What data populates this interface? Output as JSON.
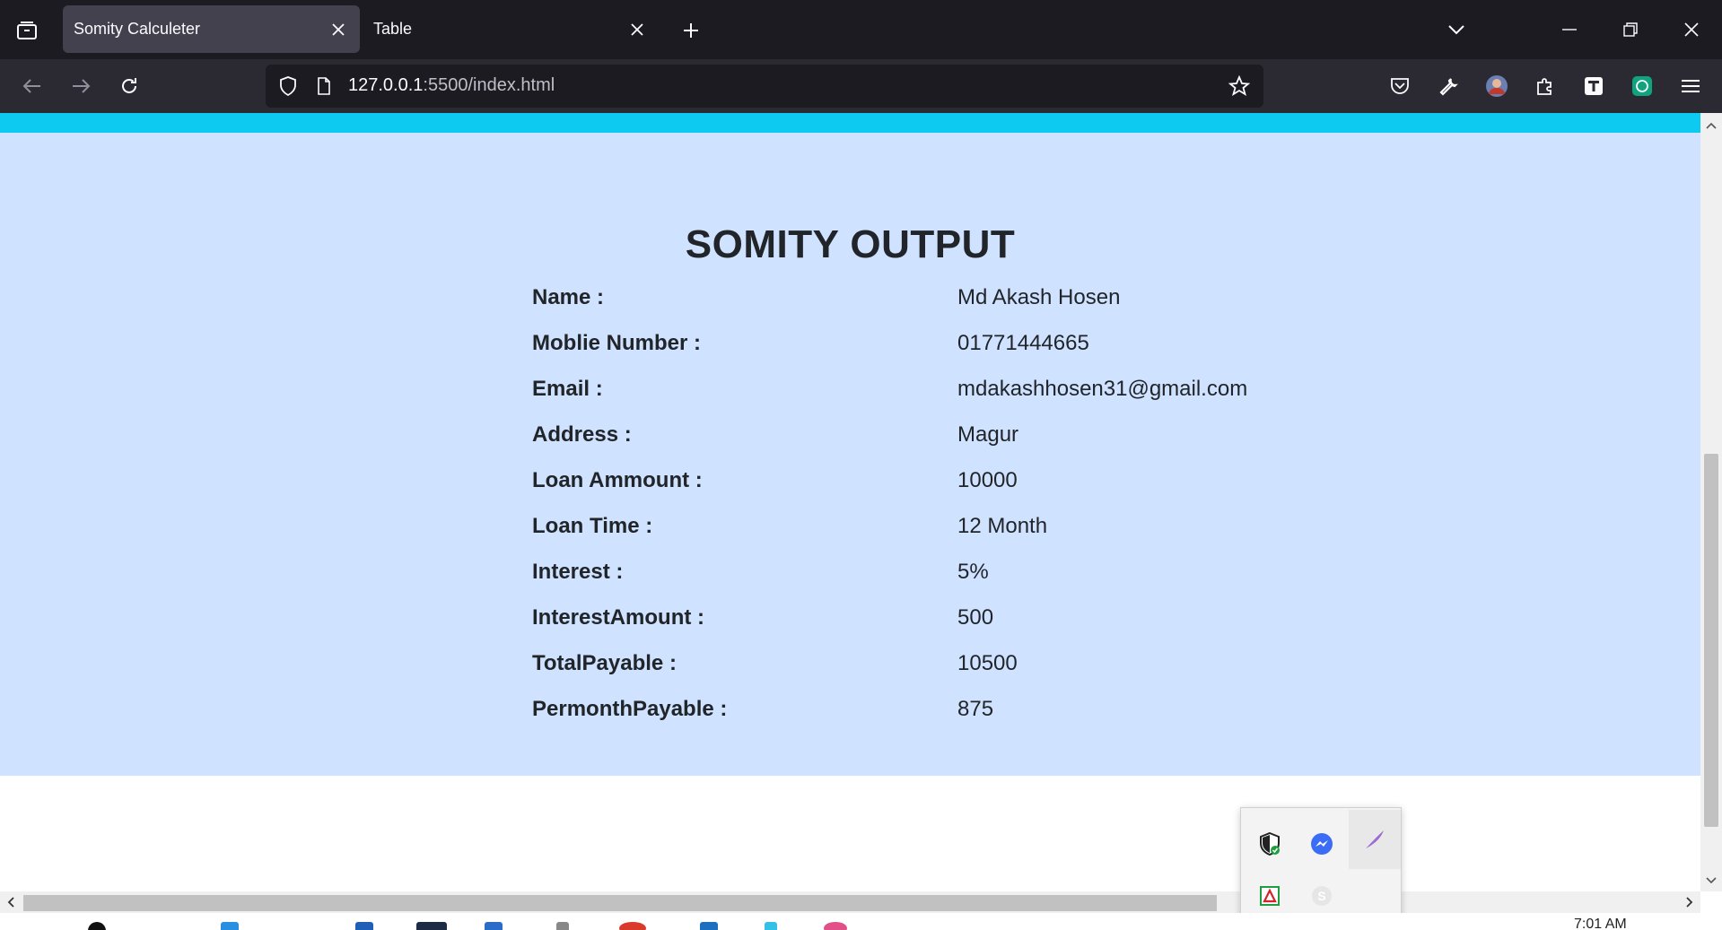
{
  "browser": {
    "tabs": [
      {
        "title": "Somity Calculeter",
        "active": true
      },
      {
        "title": "Table",
        "active": false
      }
    ],
    "url": {
      "host": "127.0.0.1",
      "rest": ":5500/index.html"
    }
  },
  "page": {
    "title": "SOMITY OUTPUT",
    "rows": [
      {
        "label": "Name :",
        "value": "Md Akash Hosen"
      },
      {
        "label": "Moblie Number :",
        "value": "01771444665"
      },
      {
        "label": "Email :",
        "value": "mdakashhosen31@gmail.com"
      },
      {
        "label": "Address :",
        "value": "Magur"
      },
      {
        "label": "Loan Ammount :",
        "value": "10000"
      },
      {
        "label": "Loan Time :",
        "value": "12 Month"
      },
      {
        "label": "Interest :",
        "value": "5%"
      },
      {
        "label": "InterestAmount :",
        "value": "500"
      },
      {
        "label": "TotalPayable :",
        "value": "10500"
      },
      {
        "label": "PermonthPayable :",
        "value": "875"
      }
    ]
  },
  "taskbar": {
    "clock": "7:01 AM"
  },
  "colors": {
    "strip": "#0dcaf0",
    "section_bg": "#cfe2ff",
    "chrome_dark": "#1c1b22",
    "chrome_mid": "#2b2a33"
  }
}
